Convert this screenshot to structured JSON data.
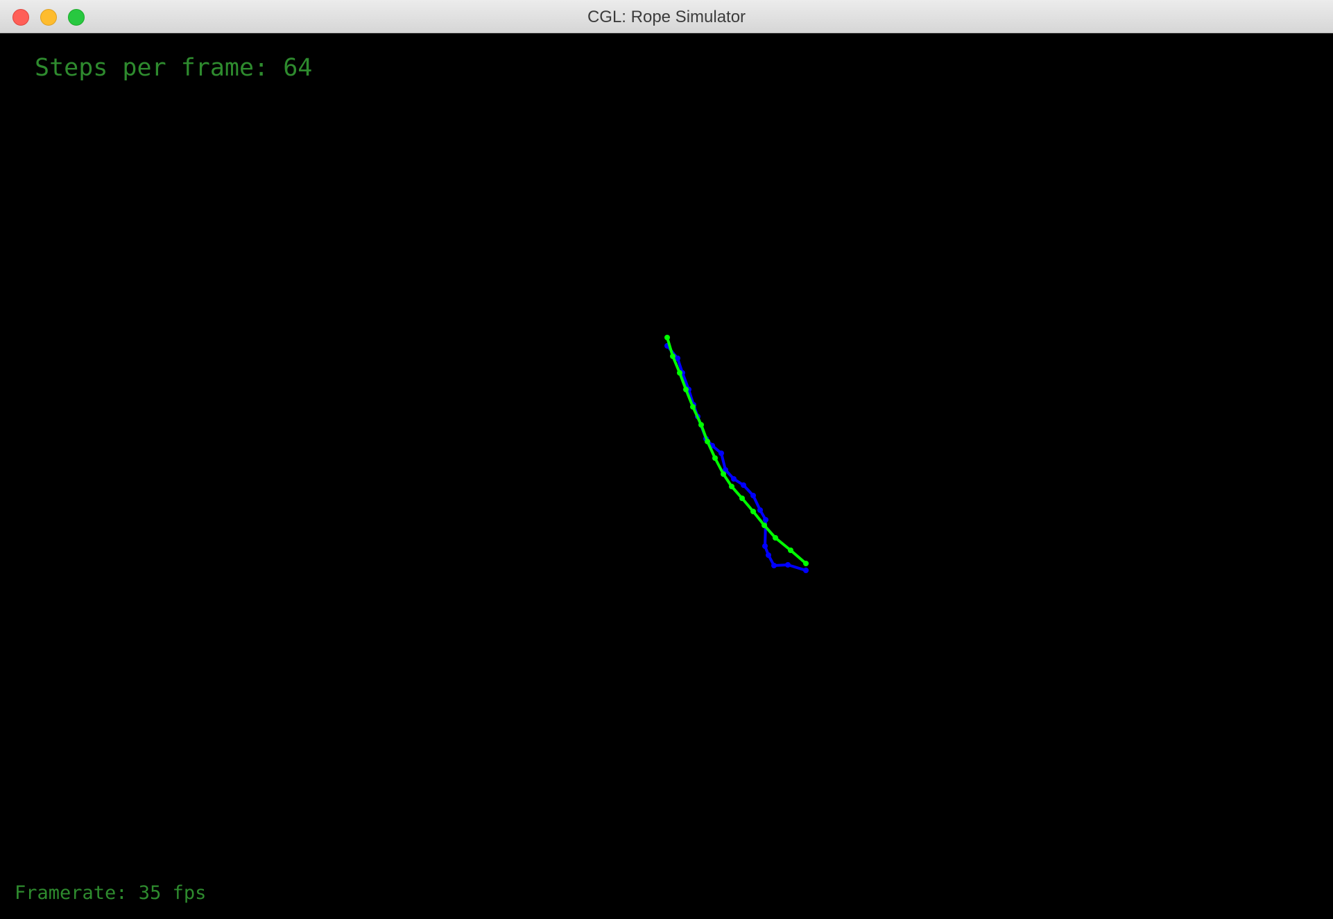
{
  "window": {
    "title": "CGL: Rope Simulator"
  },
  "hud": {
    "steps_label": "Steps per frame: 64",
    "framerate_label": "Framerate: 35 fps"
  },
  "colors": {
    "background": "#000000",
    "hud_text": "#2e8b2e",
    "rope_green": "#00ff00",
    "rope_blue": "#0000ff"
  }
}
